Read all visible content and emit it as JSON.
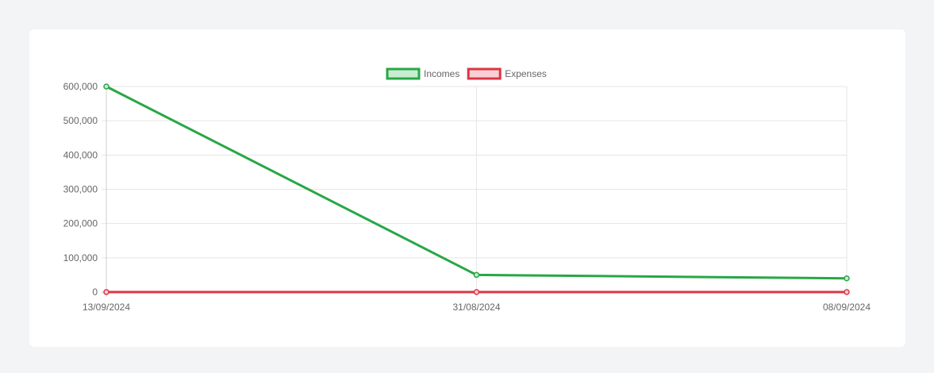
{
  "chart_data": {
    "type": "line",
    "categories": [
      "13/09/2024",
      "31/08/2024",
      "08/09/2024"
    ],
    "series": [
      {
        "name": "Incomes",
        "values": [
          600000,
          50000,
          40000
        ],
        "color": "#28a745",
        "fill": "#c9ecd1"
      },
      {
        "name": "Expenses",
        "values": [
          0,
          0,
          0
        ],
        "color": "#dc3545",
        "fill": "#f8d0d4"
      }
    ],
    "ylim": [
      0,
      600000
    ],
    "yticks": [
      "600,000",
      "500,000",
      "400,000",
      "300,000",
      "200,000",
      "100,000",
      "0"
    ],
    "grid": true,
    "legend_position": "top-center"
  }
}
